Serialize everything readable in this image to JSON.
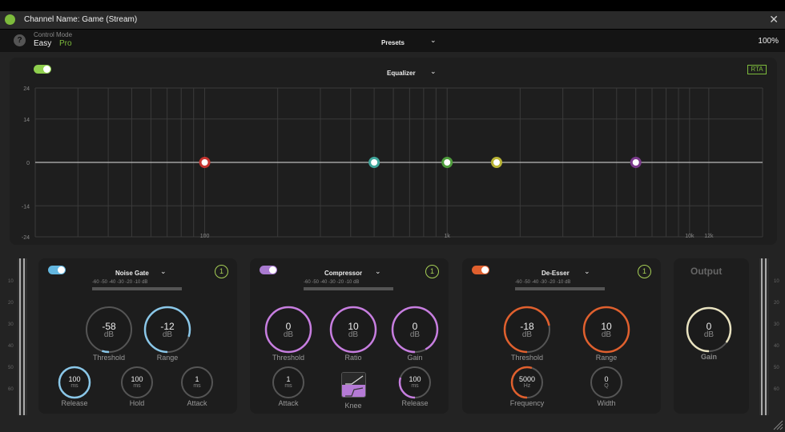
{
  "window": {
    "title": "Channel Name: Game (Stream)",
    "close": "✕"
  },
  "header": {
    "help": "?",
    "control_mode_label": "Control Mode",
    "easy_label": "Easy",
    "pro_label": "Pro",
    "presets_label": "Presets",
    "presets_chevron": "⌄",
    "zoom": "100%"
  },
  "equalizer": {
    "title": "Equalizer",
    "chevron": "⌄",
    "rta_label": "RTA",
    "enabled": true,
    "y_labels": [
      "24",
      "14",
      "0",
      "-14",
      "-24"
    ],
    "x_labels": [
      "100",
      "1k",
      "10k",
      "12k"
    ],
    "bands": [
      {
        "color": "#c4332f",
        "freq": 100
      },
      {
        "color": "#3fa59a",
        "freq": 500
      },
      {
        "color": "#4e9b3c",
        "freq": 1000
      },
      {
        "color": "#b8b335",
        "freq": 1600
      },
      {
        "color": "#7b3a8c",
        "freq": 6000
      }
    ],
    "colors": {
      "grid": "#3a3a3a",
      "zero_line": "#bbbbbb"
    }
  },
  "meter_scale": [
    "-60",
    "-50",
    "-40",
    "-30",
    "-20",
    "-10",
    "dB"
  ],
  "noise_gate": {
    "title": "Noise Gate",
    "chevron": "⌄",
    "badge": "1",
    "toggle_color": "#63b7e0",
    "threshold": {
      "value": "-58",
      "unit": "dB",
      "label": "Threshold",
      "level": 0.05
    },
    "range": {
      "value": "-12",
      "unit": "dB",
      "label": "Range",
      "level": 0.8
    },
    "release": {
      "value": "100",
      "unit": "ms",
      "label": "Release",
      "level": 1.0
    },
    "hold": {
      "value": "100",
      "unit": "ms",
      "label": "Hold",
      "level": 0.0
    },
    "attack": {
      "value": "1",
      "unit": "ms",
      "label": "Attack",
      "level": 0.0
    },
    "color": "#8ac7e8"
  },
  "compressor": {
    "title": "Compressor",
    "chevron": "⌄",
    "badge": "1",
    "toggle_color": "#a97ad0",
    "threshold": {
      "value": "0",
      "unit": "dB",
      "label": "Threshold",
      "level": 1.0
    },
    "ratio": {
      "value": "10",
      "unit": "dB",
      "label": "Ratio",
      "level": 1.0
    },
    "gain": {
      "value": "0",
      "unit": "dB",
      "label": "Gain",
      "level": 0.92
    },
    "attack": {
      "value": "1",
      "unit": "ms",
      "label": "Attack",
      "level": 0.0
    },
    "knee_label": "Knee",
    "release": {
      "value": "100",
      "unit": "ms",
      "label": "Release",
      "level": 0.3
    },
    "color": "#c77ee0"
  },
  "de_esser": {
    "title": "De-Esser",
    "chevron": "⌄",
    "badge": "1",
    "toggle_color": "#e0602e",
    "threshold": {
      "value": "-18",
      "unit": "dB",
      "label": "Threshold",
      "level": 0.72
    },
    "range": {
      "value": "10",
      "unit": "dB",
      "label": "Range",
      "level": 1.0
    },
    "frequency": {
      "value": "5000",
      "unit": "Hz",
      "label": "Frequency",
      "level": 0.55
    },
    "width": {
      "value": "0",
      "unit": "Q",
      "label": "Width",
      "level": 0.0
    },
    "color": "#e0602e"
  },
  "output": {
    "title": "Output",
    "gain": {
      "value": "0",
      "unit": "dB",
      "label": "Gain",
      "level": 0.85
    },
    "color": "#e8e2c0"
  },
  "side_meter_scale": [
    "10",
    "20",
    "30",
    "40",
    "50",
    "60"
  ]
}
